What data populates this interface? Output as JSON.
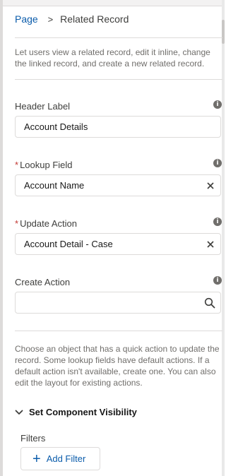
{
  "breadcrumb": {
    "parent": "Page",
    "separator": ">",
    "current": "Related Record"
  },
  "intro": "Let users view a related record, edit it inline, change the linked record, and create a new related record.",
  "fields": {
    "header_label": {
      "label": "Header Label",
      "value": "Account Details",
      "required": false
    },
    "lookup_field": {
      "label": "Lookup Field",
      "value": "Account Name",
      "required": true
    },
    "update_action": {
      "label": "Update Action",
      "value": "Account Detail - Case",
      "required": true
    },
    "create_action": {
      "label": "Create Action",
      "value": "",
      "required": false
    }
  },
  "required_marker": "*",
  "info_glyph": "i",
  "help_text": "Choose an object that has a quick action to update the record. Some lookup fields have default actions. If a default action isn't available, create one. You can also edit the layout for existing actions.",
  "visibility": {
    "section_label": "Set Component Visibility",
    "filters_label": "Filters",
    "add_filter_label": "Add Filter"
  },
  "icons": {
    "info": "info-icon",
    "clear": "close-icon",
    "search": "search-icon",
    "chevron": "chevron-down-icon",
    "add": "plus-icon"
  },
  "colors": {
    "link": "#0b5cab",
    "required": "#c23934",
    "border": "#dddbda"
  }
}
